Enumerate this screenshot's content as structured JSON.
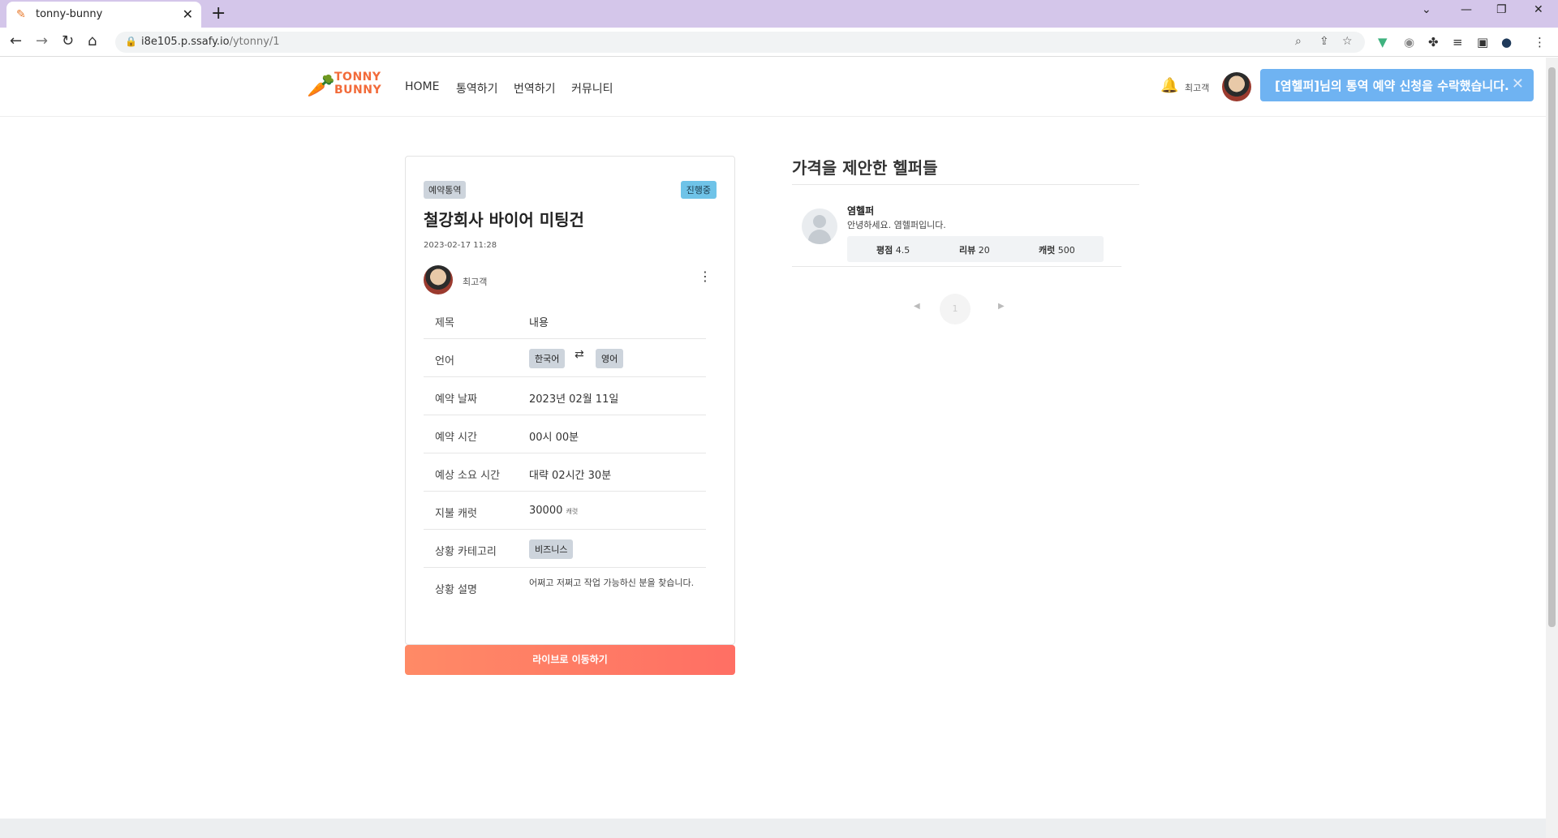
{
  "browser": {
    "tab_title": "tonny-bunny",
    "url_host": "i8e105.p.ssafy.io",
    "url_path": "/ytonny/1"
  },
  "header": {
    "logo_line1": "TONNY",
    "logo_line2": "BUNNY",
    "nav": [
      "HOME",
      "통역하기",
      "번역하기",
      "커뮤니티"
    ],
    "user_name": "최고객",
    "toast": "[염헬퍼]님의 통역 예약 신청을 수락했습니다."
  },
  "request": {
    "type_badge": "예약통역",
    "status_badge": "진행중",
    "title": "철강회사 바이어 미팅건",
    "date": "2023-02-17 11:28",
    "author": "최고객",
    "rows": {
      "subject": {
        "label": "제목",
        "value": "내용"
      },
      "language": {
        "label": "언어",
        "from": "한국어",
        "to": "영어"
      },
      "date": {
        "label": "예약 날짜",
        "value": "2023년 02월 11일"
      },
      "time": {
        "label": "예약 시간",
        "value": "00시 00분"
      },
      "duration": {
        "label": "예상 소요 시간",
        "value": "대략 02시간 30분"
      },
      "carrot": {
        "label": "지불 캐럿",
        "value": "30000",
        "unit": "캐럿"
      },
      "category": {
        "label": "상황 카테고리",
        "value": "비즈니스"
      },
      "description": {
        "label": "상황 설명",
        "value": "어쩌고 저쩌고 작업 가능하신 분을 찾습니다."
      }
    },
    "live_button": "라이브로 이동하기"
  },
  "helpers": {
    "title": "가격을 제안한 헬퍼들",
    "items": [
      {
        "name": "염헬퍼",
        "greeting": "안녕하세요. 염헬퍼입니다.",
        "rating_label": "평점",
        "rating": "4.5",
        "review_label": "리뷰",
        "reviews": "20",
        "carrot_label": "캐럿",
        "carrot": "500"
      }
    ],
    "pagination": {
      "current": "1"
    }
  }
}
